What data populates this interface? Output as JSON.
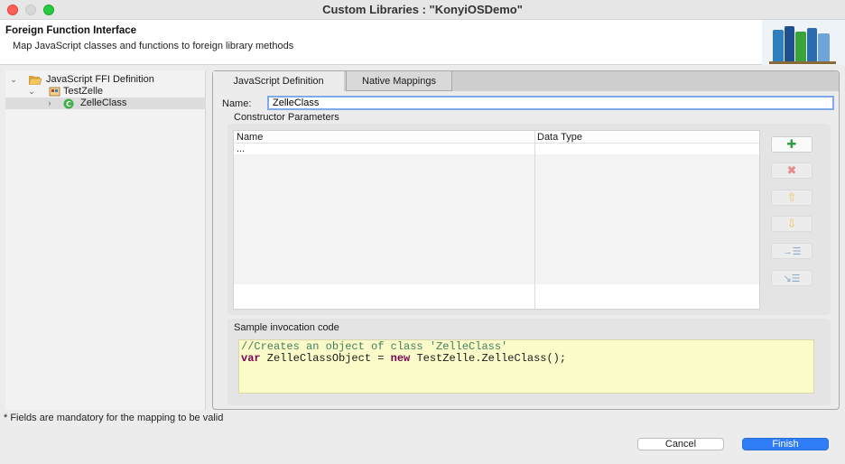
{
  "window": {
    "title": "Custom Libraries : \"KonyiOSDemo\""
  },
  "header": {
    "title": "Foreign Function Interface",
    "description": "Map JavaScript classes and functions to foreign library methods"
  },
  "tree": {
    "items": [
      {
        "label": "JavaScript FFI Definition",
        "icon": "folder-open-icon",
        "expanded": true
      },
      {
        "label": "TestZelle",
        "icon": "library-icon",
        "expanded": true
      },
      {
        "label": "ZelleClass",
        "icon": "class-icon",
        "expanded": false,
        "selected": true
      }
    ]
  },
  "tabs": [
    {
      "label": "JavaScript Definition",
      "active": true
    },
    {
      "label": "Native Mappings",
      "active": false
    }
  ],
  "form": {
    "name_label": "Name:",
    "name_value": "ZelleClass",
    "constructor_label": "Constructor Parameters",
    "columns": [
      "Name",
      "Data Type"
    ],
    "rows": [
      {
        "name": "...",
        "type": ""
      }
    ],
    "side_buttons": [
      {
        "icon": "add-icon",
        "enabled": true
      },
      {
        "icon": "delete-icon",
        "enabled": false
      },
      {
        "icon": "move-up-icon",
        "enabled": false
      },
      {
        "icon": "move-down-icon",
        "enabled": false
      },
      {
        "icon": "indent-icon",
        "enabled": false
      },
      {
        "icon": "outdent-icon",
        "enabled": false
      }
    ],
    "sample_label": "Sample invocation code",
    "code_comment": "//Creates an object of class 'ZelleClass'",
    "code_kw_var": "var",
    "code_mid": " ZelleClassObject = ",
    "code_kw_new": "new",
    "code_tail": " TestZelle.ZelleClass();"
  },
  "footnote": "* Fields are mandatory for the mapping to be valid",
  "buttons": {
    "cancel": "Cancel",
    "finish": "Finish"
  },
  "colors": {
    "accent": "#2e7cf6",
    "code_bg": "#fbfbc9",
    "comment": "#3f7f5f",
    "keyword": "#7f0055"
  }
}
